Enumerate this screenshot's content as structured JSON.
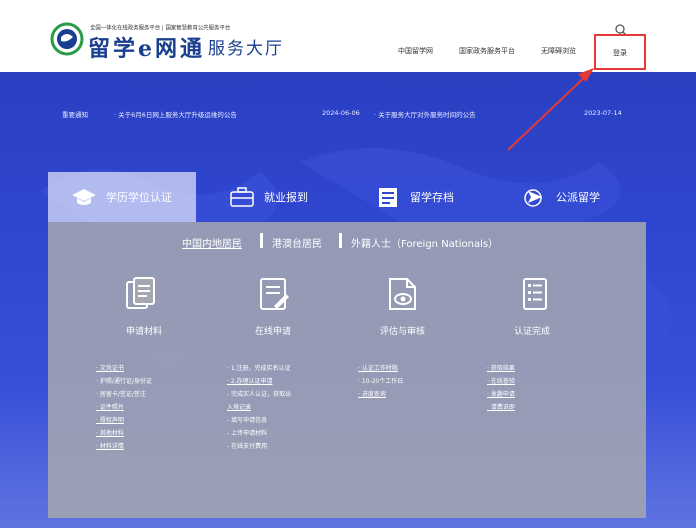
{
  "header": {
    "tagline": "全国一体化在线政务服务平台 | 国家智慧教育公共服务平台",
    "logo_title": "留学e网通",
    "logo_sub": "服务大厅",
    "nav": [
      "中国留学网",
      "国家政务服务平台",
      "无障碍浏览"
    ],
    "login_label": "登录"
  },
  "notices": {
    "heading": "重要通知",
    "items": [
      {
        "title": "· 关于6月6日网上服务大厅升级运维的公告",
        "date": "2024-06-06"
      },
      {
        "title": "· 关于服务大厅对外服务时间的公告",
        "date": "2023-07-14"
      }
    ]
  },
  "tabs": [
    {
      "label": "学历学位认证",
      "icon": "graduation-cap-icon",
      "active": true
    },
    {
      "label": "就业报到",
      "icon": "briefcase-icon",
      "active": false
    },
    {
      "label": "留学存档",
      "icon": "archive-icon",
      "active": false
    },
    {
      "label": "公派留学",
      "icon": "plane-icon",
      "active": false
    }
  ],
  "residency": [
    "中国内地居民",
    "港澳台居民",
    "外籍人士（Foreign Nationals）"
  ],
  "steps": [
    {
      "label": "申请材料",
      "icon": "documents-icon"
    },
    {
      "label": "在线申请",
      "icon": "edit-form-icon"
    },
    {
      "label": "评估与审核",
      "icon": "review-eye-icon"
    },
    {
      "label": "认证完成",
      "icon": "completed-list-icon"
    }
  ],
  "columns": [
    [
      "· 文凭证书",
      "· 护照/通行证/身份证",
      "· 居留卡/签证/签注",
      "· 证件照片",
      "· 授权声明",
      "· 其他材料",
      "· 材料详情"
    ],
    [
      "· 1.注册，完成实名认证",
      "· 2.办理认证申请",
      "   - 完成实人认证，获取出",
      "     入境记录",
      "   - 填写申请信息",
      "   - 上传申请材料",
      "   - 在线支付费用"
    ],
    [
      "· 认证工作时限",
      "· 10-20个工作日",
      "· 进度查询"
    ],
    [
      "· 获取结果",
      "· 在线查验",
      "· 发趣申请",
      "· 请费说即"
    ]
  ],
  "colors": {
    "brand": "#1a3f8f",
    "hero": "#2f46d0",
    "highlight": "#e53935"
  }
}
